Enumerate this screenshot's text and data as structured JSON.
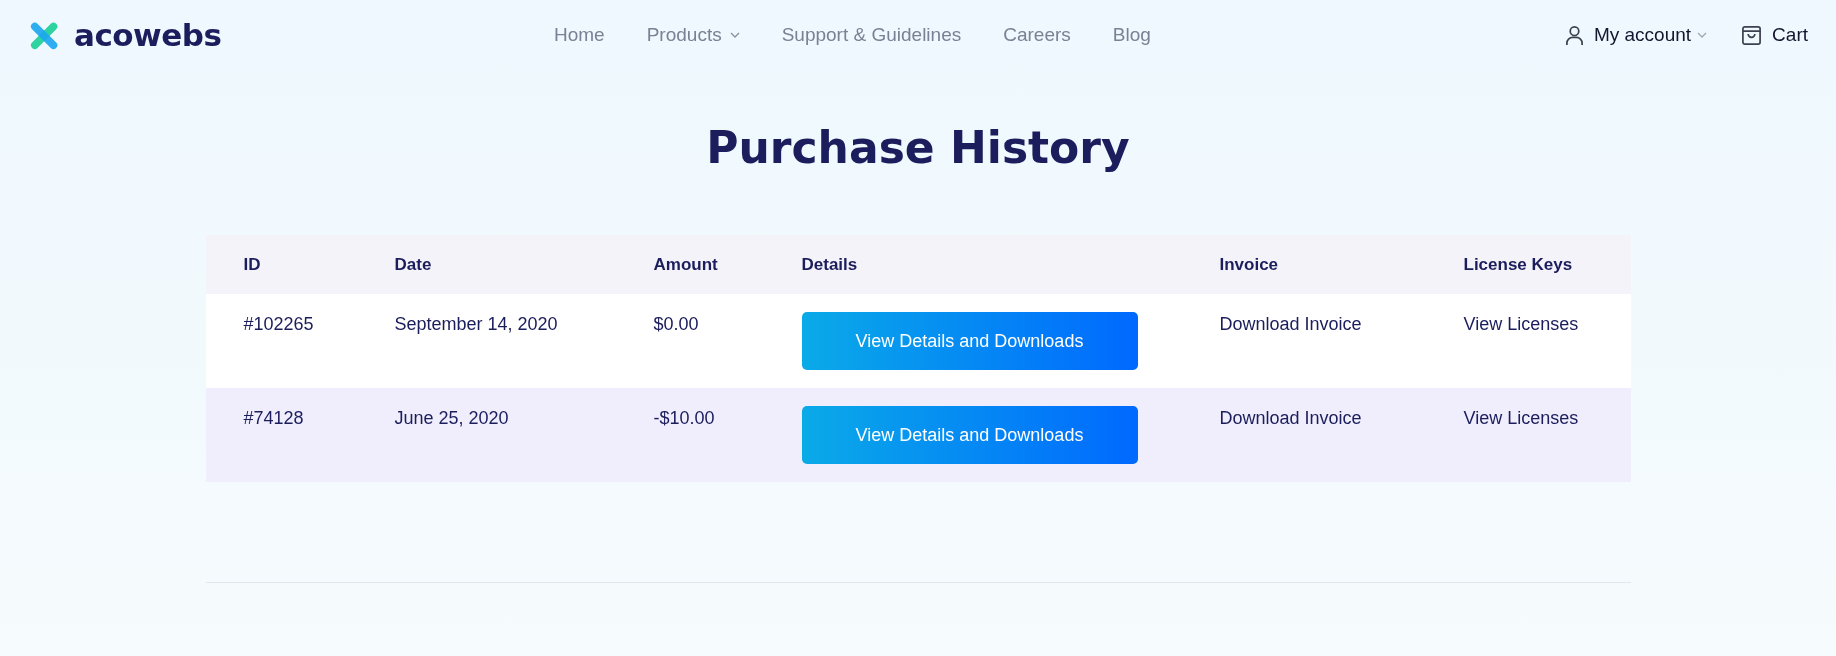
{
  "logo": {
    "text": "acowebs"
  },
  "nav": [
    {
      "label": "Home",
      "dropdown": false
    },
    {
      "label": "Products",
      "dropdown": true
    },
    {
      "label": "Support & Guidelines",
      "dropdown": false
    },
    {
      "label": "Careers",
      "dropdown": false
    },
    {
      "label": "Blog",
      "dropdown": false
    }
  ],
  "account": {
    "label": "My account"
  },
  "cart": {
    "label": "Cart"
  },
  "title": "Purchase History",
  "table": {
    "columns": [
      "ID",
      "Date",
      "Amount",
      "Details",
      "Invoice",
      "License Keys"
    ],
    "rows": [
      {
        "id": "#102265",
        "date": "September 14, 2020",
        "amount": "$0.00",
        "details": "View Details and Downloads",
        "invoice": "Download Invoice",
        "licenses": "View Licenses"
      },
      {
        "id": "#74128",
        "date": "June 25, 2020",
        "amount": "-$10.00",
        "details": "View Details and Downloads",
        "invoice": "Download Invoice",
        "licenses": "View Licenses"
      }
    ]
  }
}
